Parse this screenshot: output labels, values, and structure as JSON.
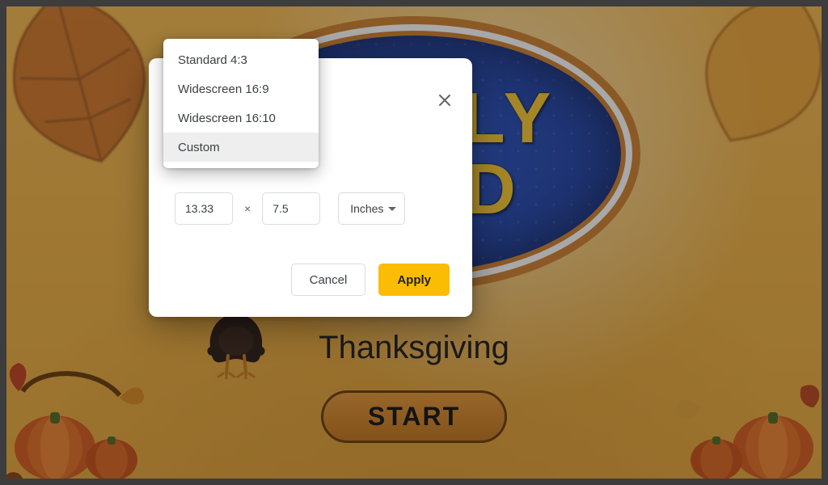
{
  "slide": {
    "logo_line1": "FAMILY",
    "logo_line2": "FEUD",
    "subtitle": "Thanksgiving",
    "start_label": "START"
  },
  "dialog": {
    "width_value": "13.33",
    "height_value": "7.5",
    "multiply_symbol": "×",
    "unit_label": "Inches",
    "cancel_label": "Cancel",
    "apply_label": "Apply"
  },
  "menu": {
    "options": [
      {
        "label": "Standard 4:3",
        "selected": false
      },
      {
        "label": "Widescreen 16:9",
        "selected": false
      },
      {
        "label": "Widescreen 16:10",
        "selected": false
      },
      {
        "label": "Custom",
        "selected": true
      }
    ]
  }
}
